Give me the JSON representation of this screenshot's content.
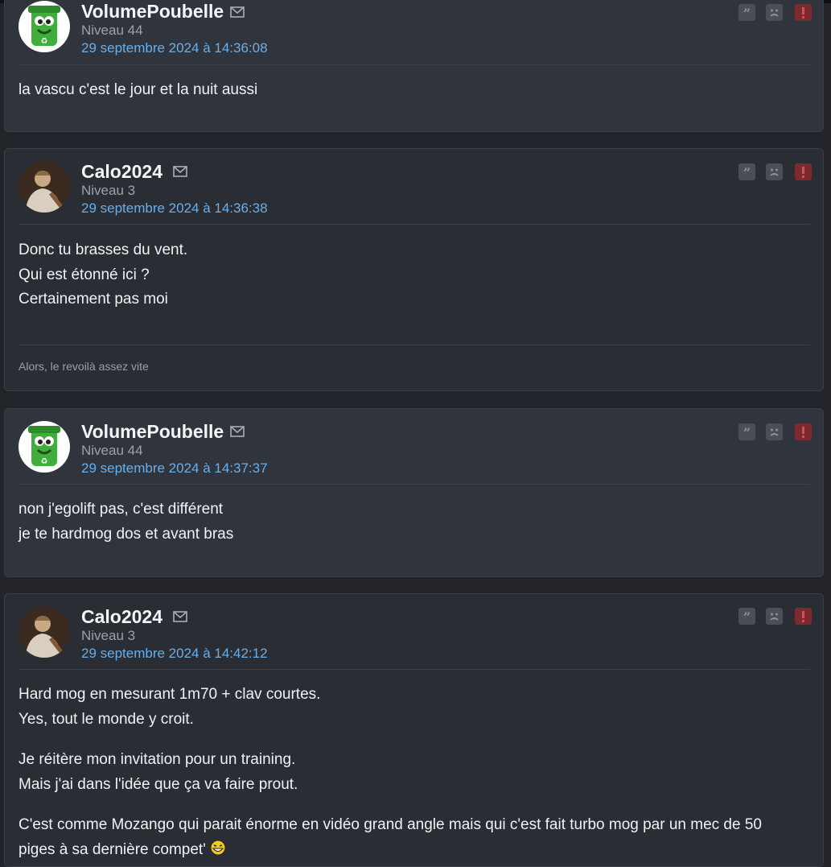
{
  "posts": [
    {
      "author": "VolumePoubelle",
      "level": "Niveau 44",
      "date": "29 septembre 2024 à 14:36:08",
      "lines": [
        "la vascu c'est le jour et la nuit aussi"
      ]
    },
    {
      "author": "Calo2024",
      "level": "Niveau 3",
      "date": "29 septembre 2024 à 14:36:38",
      "lines": [
        "Donc tu brasses du vent.",
        "Qui est étonné ici ?",
        "Certainement pas moi"
      ],
      "signature": "Alors, le revoilà assez vite"
    },
    {
      "author": "VolumePoubelle",
      "level": "Niveau 44",
      "date": "29 septembre 2024 à 14:37:37",
      "lines": [
        "non j'egolift pas, c'est différent",
        "je te hardmog dos et avant bras"
      ]
    },
    {
      "author": "Calo2024",
      "level": "Niveau 3",
      "date": "29 septembre 2024 à 14:42:12",
      "paragraphs": [
        [
          "Hard mog en mesurant 1m70 + clav courtes.",
          "Yes, tout le monde y croit."
        ],
        [
          "Je réitère mon invitation pour un training.",
          "Mais j'ai dans l'idée que ça va faire prout."
        ],
        [
          "C'est comme Mozango qui parait énorme en vidéo grand angle mais qui c'est fait turbo mog par un mec de 50",
          "piges à sa dernière compet' "
        ]
      ]
    }
  ],
  "icons": {
    "quote": "quote-icon",
    "sad": "sad-face-icon",
    "alert": "alert-icon",
    "mail": "mail-icon"
  },
  "colors": {
    "date": "#6aaee8",
    "alert_button": "#7c2a2d"
  }
}
